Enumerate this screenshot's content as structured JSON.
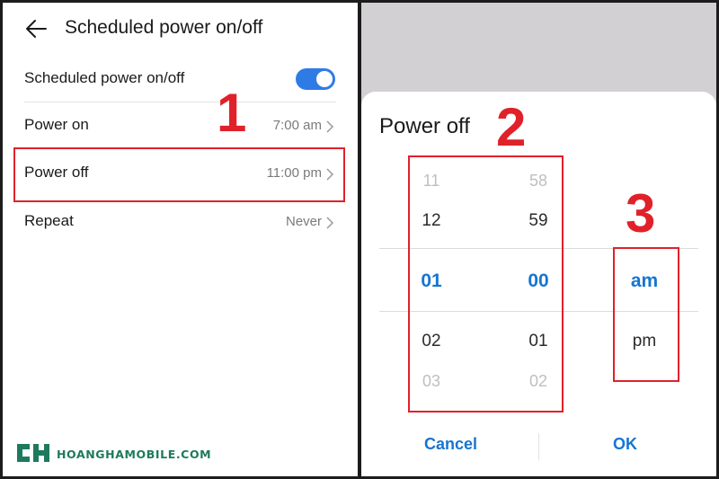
{
  "left": {
    "title": "Scheduled power on/off",
    "toggle_row": {
      "label": "Scheduled power on/off",
      "enabled": true
    },
    "rows": [
      {
        "label": "Power on",
        "value": "7:00 am"
      },
      {
        "label": "Power off",
        "value": "11:00 pm"
      },
      {
        "label": "Repeat",
        "value": "Never"
      }
    ],
    "step_number": "1",
    "logo_text": "HOANGHAMOBILE.COM"
  },
  "right": {
    "dialog_title": "Power off",
    "hours": {
      "above2": "11",
      "above1": "12",
      "selected": "01",
      "below1": "02",
      "below2": "03"
    },
    "minutes": {
      "above2": "58",
      "above1": "59",
      "selected": "00",
      "below1": "01",
      "below2": "02"
    },
    "period": {
      "selected": "am",
      "other": "pm"
    },
    "cancel_label": "Cancel",
    "ok_label": "OK",
    "step_number_2": "2",
    "step_number_3": "3"
  },
  "colors": {
    "accent": "#2f7be6",
    "highlight_red": "#e0212a",
    "picker_selected": "#1675d1",
    "logo_green": "#1e7a5c"
  }
}
